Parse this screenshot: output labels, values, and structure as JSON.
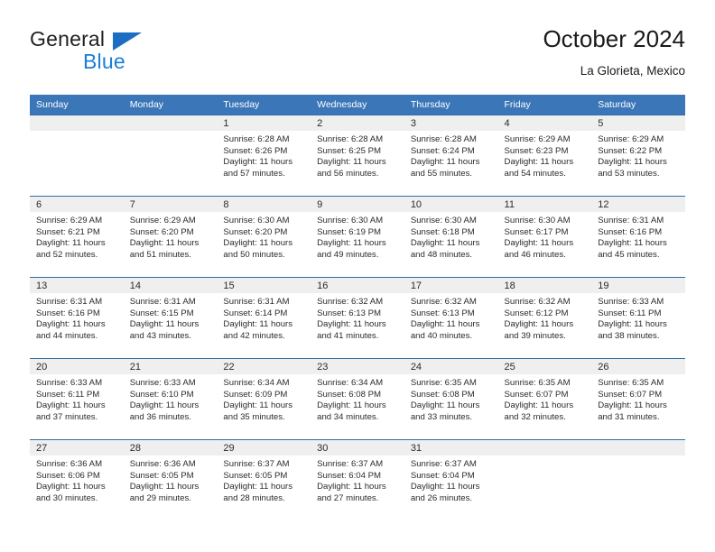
{
  "brand": {
    "name_top": "General",
    "name_bottom": "Blue",
    "triangle_color": "#1b6ec2",
    "blue_text_color": "#1b7ed6"
  },
  "header": {
    "title": "October 2024",
    "subtitle": "La Glorieta, Mexico"
  },
  "colors": {
    "header_blue": "#3b76b8",
    "row_rule_blue": "#2e6da4",
    "daynum_band": "#efefef"
  },
  "weekdays": [
    "Sunday",
    "Monday",
    "Tuesday",
    "Wednesday",
    "Thursday",
    "Friday",
    "Saturday"
  ],
  "weeks": [
    [
      {
        "day": "",
        "empty": true
      },
      {
        "day": "",
        "empty": true
      },
      {
        "day": "1",
        "sunrise": "Sunrise: 6:28 AM",
        "sunset": "Sunset: 6:26 PM",
        "daylight1": "Daylight: 11 hours",
        "daylight2": "and 57 minutes."
      },
      {
        "day": "2",
        "sunrise": "Sunrise: 6:28 AM",
        "sunset": "Sunset: 6:25 PM",
        "daylight1": "Daylight: 11 hours",
        "daylight2": "and 56 minutes."
      },
      {
        "day": "3",
        "sunrise": "Sunrise: 6:28 AM",
        "sunset": "Sunset: 6:24 PM",
        "daylight1": "Daylight: 11 hours",
        "daylight2": "and 55 minutes."
      },
      {
        "day": "4",
        "sunrise": "Sunrise: 6:29 AM",
        "sunset": "Sunset: 6:23 PM",
        "daylight1": "Daylight: 11 hours",
        "daylight2": "and 54 minutes."
      },
      {
        "day": "5",
        "sunrise": "Sunrise: 6:29 AM",
        "sunset": "Sunset: 6:22 PM",
        "daylight1": "Daylight: 11 hours",
        "daylight2": "and 53 minutes."
      }
    ],
    [
      {
        "day": "6",
        "sunrise": "Sunrise: 6:29 AM",
        "sunset": "Sunset: 6:21 PM",
        "daylight1": "Daylight: 11 hours",
        "daylight2": "and 52 minutes."
      },
      {
        "day": "7",
        "sunrise": "Sunrise: 6:29 AM",
        "sunset": "Sunset: 6:20 PM",
        "daylight1": "Daylight: 11 hours",
        "daylight2": "and 51 minutes."
      },
      {
        "day": "8",
        "sunrise": "Sunrise: 6:30 AM",
        "sunset": "Sunset: 6:20 PM",
        "daylight1": "Daylight: 11 hours",
        "daylight2": "and 50 minutes."
      },
      {
        "day": "9",
        "sunrise": "Sunrise: 6:30 AM",
        "sunset": "Sunset: 6:19 PM",
        "daylight1": "Daylight: 11 hours",
        "daylight2": "and 49 minutes."
      },
      {
        "day": "10",
        "sunrise": "Sunrise: 6:30 AM",
        "sunset": "Sunset: 6:18 PM",
        "daylight1": "Daylight: 11 hours",
        "daylight2": "and 48 minutes."
      },
      {
        "day": "11",
        "sunrise": "Sunrise: 6:30 AM",
        "sunset": "Sunset: 6:17 PM",
        "daylight1": "Daylight: 11 hours",
        "daylight2": "and 46 minutes."
      },
      {
        "day": "12",
        "sunrise": "Sunrise: 6:31 AM",
        "sunset": "Sunset: 6:16 PM",
        "daylight1": "Daylight: 11 hours",
        "daylight2": "and 45 minutes."
      }
    ],
    [
      {
        "day": "13",
        "sunrise": "Sunrise: 6:31 AM",
        "sunset": "Sunset: 6:16 PM",
        "daylight1": "Daylight: 11 hours",
        "daylight2": "and 44 minutes."
      },
      {
        "day": "14",
        "sunrise": "Sunrise: 6:31 AM",
        "sunset": "Sunset: 6:15 PM",
        "daylight1": "Daylight: 11 hours",
        "daylight2": "and 43 minutes."
      },
      {
        "day": "15",
        "sunrise": "Sunrise: 6:31 AM",
        "sunset": "Sunset: 6:14 PM",
        "daylight1": "Daylight: 11 hours",
        "daylight2": "and 42 minutes."
      },
      {
        "day": "16",
        "sunrise": "Sunrise: 6:32 AM",
        "sunset": "Sunset: 6:13 PM",
        "daylight1": "Daylight: 11 hours",
        "daylight2": "and 41 minutes."
      },
      {
        "day": "17",
        "sunrise": "Sunrise: 6:32 AM",
        "sunset": "Sunset: 6:13 PM",
        "daylight1": "Daylight: 11 hours",
        "daylight2": "and 40 minutes."
      },
      {
        "day": "18",
        "sunrise": "Sunrise: 6:32 AM",
        "sunset": "Sunset: 6:12 PM",
        "daylight1": "Daylight: 11 hours",
        "daylight2": "and 39 minutes."
      },
      {
        "day": "19",
        "sunrise": "Sunrise: 6:33 AM",
        "sunset": "Sunset: 6:11 PM",
        "daylight1": "Daylight: 11 hours",
        "daylight2": "and 38 minutes."
      }
    ],
    [
      {
        "day": "20",
        "sunrise": "Sunrise: 6:33 AM",
        "sunset": "Sunset: 6:11 PM",
        "daylight1": "Daylight: 11 hours",
        "daylight2": "and 37 minutes."
      },
      {
        "day": "21",
        "sunrise": "Sunrise: 6:33 AM",
        "sunset": "Sunset: 6:10 PM",
        "daylight1": "Daylight: 11 hours",
        "daylight2": "and 36 minutes."
      },
      {
        "day": "22",
        "sunrise": "Sunrise: 6:34 AM",
        "sunset": "Sunset: 6:09 PM",
        "daylight1": "Daylight: 11 hours",
        "daylight2": "and 35 minutes."
      },
      {
        "day": "23",
        "sunrise": "Sunrise: 6:34 AM",
        "sunset": "Sunset: 6:08 PM",
        "daylight1": "Daylight: 11 hours",
        "daylight2": "and 34 minutes."
      },
      {
        "day": "24",
        "sunrise": "Sunrise: 6:35 AM",
        "sunset": "Sunset: 6:08 PM",
        "daylight1": "Daylight: 11 hours",
        "daylight2": "and 33 minutes."
      },
      {
        "day": "25",
        "sunrise": "Sunrise: 6:35 AM",
        "sunset": "Sunset: 6:07 PM",
        "daylight1": "Daylight: 11 hours",
        "daylight2": "and 32 minutes."
      },
      {
        "day": "26",
        "sunrise": "Sunrise: 6:35 AM",
        "sunset": "Sunset: 6:07 PM",
        "daylight1": "Daylight: 11 hours",
        "daylight2": "and 31 minutes."
      }
    ],
    [
      {
        "day": "27",
        "sunrise": "Sunrise: 6:36 AM",
        "sunset": "Sunset: 6:06 PM",
        "daylight1": "Daylight: 11 hours",
        "daylight2": "and 30 minutes."
      },
      {
        "day": "28",
        "sunrise": "Sunrise: 6:36 AM",
        "sunset": "Sunset: 6:05 PM",
        "daylight1": "Daylight: 11 hours",
        "daylight2": "and 29 minutes."
      },
      {
        "day": "29",
        "sunrise": "Sunrise: 6:37 AM",
        "sunset": "Sunset: 6:05 PM",
        "daylight1": "Daylight: 11 hours",
        "daylight2": "and 28 minutes."
      },
      {
        "day": "30",
        "sunrise": "Sunrise: 6:37 AM",
        "sunset": "Sunset: 6:04 PM",
        "daylight1": "Daylight: 11 hours",
        "daylight2": "and 27 minutes."
      },
      {
        "day": "31",
        "sunrise": "Sunrise: 6:37 AM",
        "sunset": "Sunset: 6:04 PM",
        "daylight1": "Daylight: 11 hours",
        "daylight2": "and 26 minutes."
      },
      {
        "day": "",
        "empty": true
      },
      {
        "day": "",
        "empty": true
      }
    ]
  ]
}
